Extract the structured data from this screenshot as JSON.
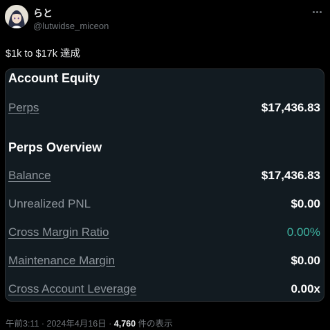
{
  "author": {
    "display_name": "らと",
    "handle": "@lutwidse_miceon"
  },
  "tweet_text": "$1k to $17k 達成",
  "card": {
    "account_equity": {
      "title": "Account Equity",
      "perps_label": "Perps",
      "perps_value": "$17,436.83"
    },
    "perps_overview": {
      "title": "Perps Overview",
      "rows": [
        {
          "label": "Balance",
          "value": "$17,436.83"
        },
        {
          "label": "Unrealized PNL",
          "value": "$0.00"
        },
        {
          "label": "Cross Margin Ratio",
          "value": "0.00%"
        },
        {
          "label": "Maintenance Margin",
          "value": "$0.00"
        },
        {
          "label": "Cross Account Leverage",
          "value": "0.00x"
        }
      ]
    }
  },
  "footer": {
    "timestamp": "午前3:11 · 2024年4月16日 · ",
    "views_count": "4,760",
    "views_suffix": " 件の表示"
  },
  "colors": {
    "background": "#000000",
    "card_background": "#121b21",
    "accent_teal": "#3fb5a3",
    "muted_text": "#71767b"
  },
  "icons": [
    "avatar",
    "more-icon"
  ]
}
